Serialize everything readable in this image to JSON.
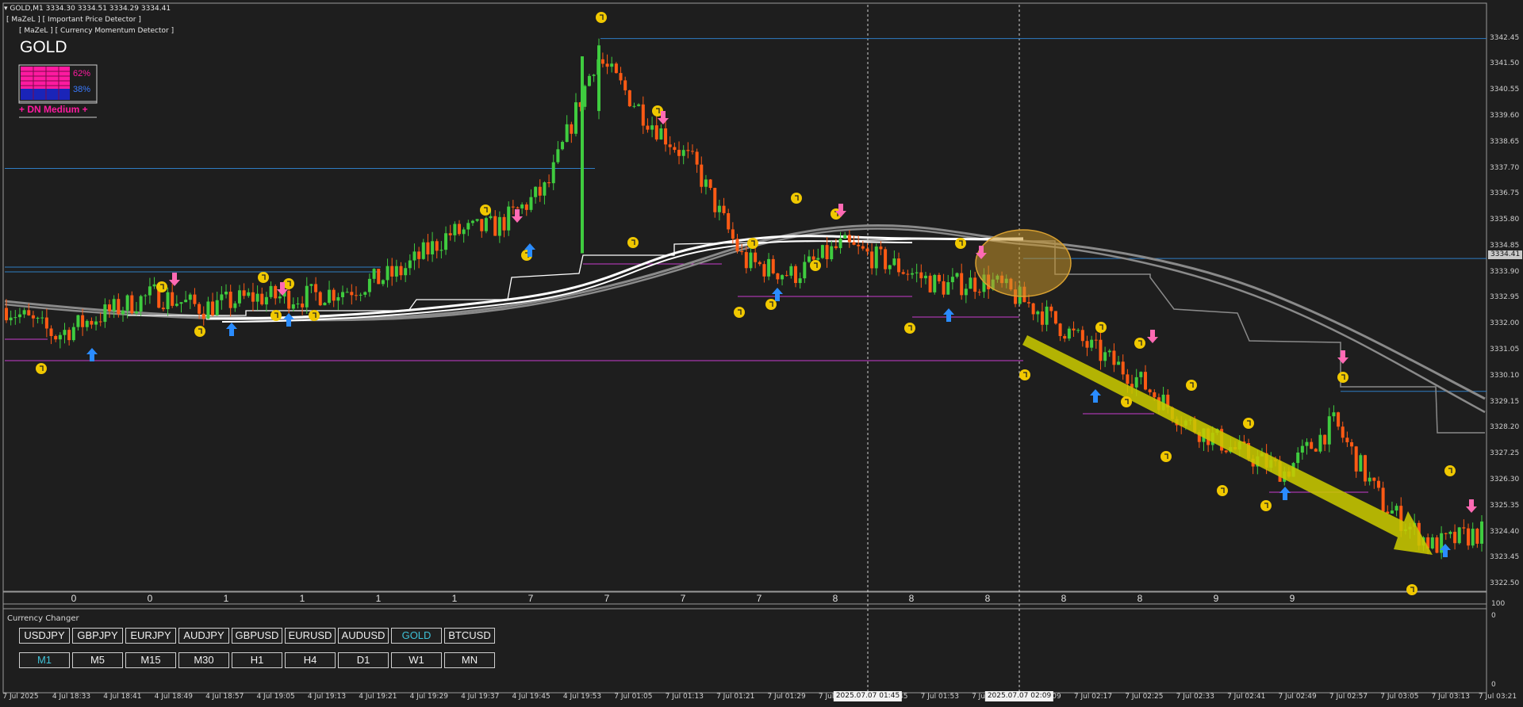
{
  "header": {
    "symbol_line": "GOLD,M1  3334.30 3334.51 3334.29 3334.41",
    "indicator_1": "[ MaZeL ] [ Important Price Detector ]",
    "indicator_2": "[ MaZeL ] [ Currency Momentum Detector ]"
  },
  "panel": {
    "symbol": "GOLD",
    "bear_pct": "62%",
    "bull_pct": "38%",
    "signal": "+ DN Medium +"
  },
  "colors": {
    "background": "#1e1e1e",
    "bull_candle": "#3fcc3f",
    "bear_candle": "#ff5a14",
    "level_line": "#2f7dc4",
    "support_line": "#c83ccf",
    "arrow_up": "#2a8cff",
    "arrow_down": "#ff6ab4",
    "trend_arrow": "#c8c800",
    "highlight_ellipse": "#c8962a",
    "signal_dot": "#f0c800",
    "active_button": "#3ec0d6"
  },
  "price_axis": [
    "3342.45",
    "3341.50",
    "3340.55",
    "3339.60",
    "3338.65",
    "3337.70",
    "3336.75",
    "3335.80",
    "3334.85",
    "3333.90",
    "3332.95",
    "3332.00",
    "3331.05",
    "3330.10",
    "3329.15",
    "3328.20",
    "3327.25",
    "3326.30",
    "3325.35",
    "3324.40",
    "3323.45",
    "3322.50"
  ],
  "current_price": "3334.41",
  "strength_row": [
    "0",
    "0",
    "1",
    "1",
    "1",
    "1",
    "7",
    "7",
    "7",
    "7",
    "8",
    "8",
    "8",
    "8",
    "8",
    "9",
    "9"
  ],
  "sub_scale": {
    "top": "100",
    "zero": "0",
    "bottom": "0"
  },
  "time_axis": [
    "7 Jul 2025",
    "4 Jul 18:33",
    "4 Jul 18:41",
    "4 Jul 18:49",
    "4 Jul 18:57",
    "4 Jul 19:05",
    "4 Jul 19:13",
    "4 Jul 19:21",
    "4 Jul 19:29",
    "4 Jul 19:37",
    "4 Jul 19:45",
    "4 Jul 19:53",
    "7 Jul 01:05",
    "7 Jul 01:13",
    "7 Jul 01:21",
    "7 Jul 01:29",
    "7 Jul 01:37",
    "7 Jul 01:45",
    "7 Jul 01:53",
    "7 Jul 02:01",
    "7 Jul 02:09",
    "7 Jul 02:17",
    "7 Jul 02:25",
    "7 Jul 02:33",
    "7 Jul 02:41",
    "7 Jul 02:49",
    "7 Jul 02:57",
    "7 Jul 03:05",
    "7 Jul 03:13",
    "7 Jul 03:21"
  ],
  "time_highlights": [
    "2025.07.07 01:45",
    "2025.07.07 02:09"
  ],
  "currency_changer": {
    "title": "Currency Changer",
    "symbols": [
      "USDJPY",
      "GBPJPY",
      "EURJPY",
      "AUDJPY",
      "GBPUSD",
      "EURUSD",
      "AUDUSD",
      "GOLD",
      "BTCUSD"
    ],
    "active_symbol": "GOLD",
    "timeframes": [
      "M1",
      "M5",
      "M15",
      "M30",
      "H1",
      "H4",
      "D1",
      "W1",
      "MN"
    ],
    "active_timeframe": "M1"
  },
  "chart_data": {
    "type": "candlestick",
    "title": "GOLD,M1",
    "ylim": [
      3322.3,
      3342.7
    ],
    "x_first": "4 Jul 18:25",
    "x_last": "7 Jul 03:23",
    "approx_close_path": [
      {
        "t": "4 Jul 18:25",
        "p": 3332.6
      },
      {
        "t": "4 Jul 18:33",
        "p": 3331.6
      },
      {
        "t": "4 Jul 18:41",
        "p": 3332.4
      },
      {
        "t": "4 Jul 18:49",
        "p": 3333.1
      },
      {
        "t": "4 Jul 18:57",
        "p": 3332.6
      },
      {
        "t": "4 Jul 19:05",
        "p": 3333.0
      },
      {
        "t": "4 Jul 19:13",
        "p": 3333.0
      },
      {
        "t": "4 Jul 19:21",
        "p": 3333.3
      },
      {
        "t": "4 Jul 19:29",
        "p": 3333.9
      },
      {
        "t": "4 Jul 19:37",
        "p": 3335.3
      },
      {
        "t": "4 Jul 19:45",
        "p": 3335.6
      },
      {
        "t": "4 Jul 19:53",
        "p": 3337.0
      },
      {
        "t": "7 Jul 01:01",
        "p": 3341.8
      },
      {
        "t": "7 Jul 01:05",
        "p": 3339.6
      },
      {
        "t": "7 Jul 01:13",
        "p": 3337.8
      },
      {
        "t": "7 Jul 01:21",
        "p": 3334.3
      },
      {
        "t": "7 Jul 01:29",
        "p": 3333.8
      },
      {
        "t": "7 Jul 01:37",
        "p": 3334.9
      },
      {
        "t": "7 Jul 01:45",
        "p": 3334.2
      },
      {
        "t": "7 Jul 01:53",
        "p": 3333.4
      },
      {
        "t": "7 Jul 02:01",
        "p": 3333.6
      },
      {
        "t": "7 Jul 02:09",
        "p": 3332.5
      },
      {
        "t": "7 Jul 02:17",
        "p": 3331.2
      },
      {
        "t": "7 Jul 02:25",
        "p": 3330.0
      },
      {
        "t": "7 Jul 02:33",
        "p": 3328.4
      },
      {
        "t": "7 Jul 02:41",
        "p": 3327.4
      },
      {
        "t": "7 Jul 02:49",
        "p": 3326.6
      },
      {
        "t": "7 Jul 02:57",
        "p": 3328.4
      },
      {
        "t": "7 Jul 03:05",
        "p": 3325.4
      },
      {
        "t": "7 Jul 03:13",
        "p": 3323.9
      },
      {
        "t": "7 Jul 03:21",
        "p": 3324.4
      }
    ],
    "horizontal_levels": [
      3342.45,
      3337.7,
      3334.41,
      3333.9,
      3329.55
    ]
  }
}
